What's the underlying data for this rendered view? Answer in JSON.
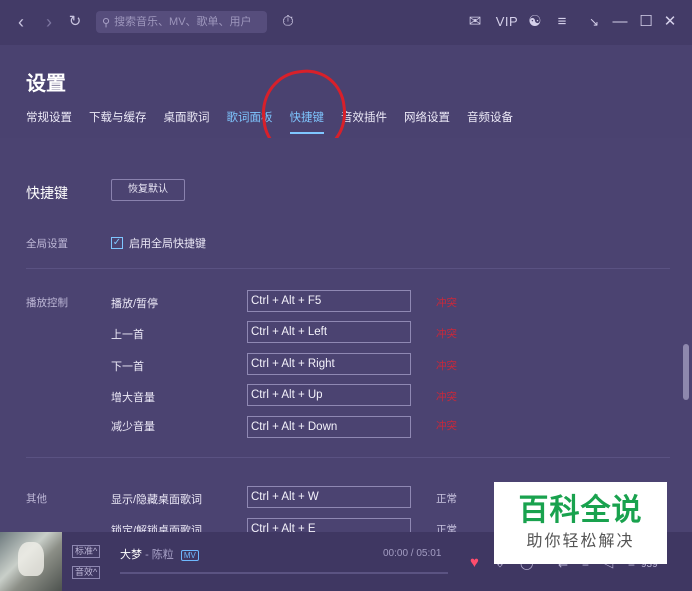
{
  "topbar": {
    "back_icon": "chevron-left-icon",
    "forward_icon": "chevron-right-icon",
    "refresh_icon": "refresh-icon",
    "search_placeholder": "搜索音乐、MV、歌单、用户",
    "recognize_icon": "music-recognize-icon",
    "mail_icon": "mail-icon",
    "vip_label": "VIP",
    "skin_icon": "shirt-icon",
    "menu_icon": "menu-icon",
    "minimode_icon": "mini-mode-icon",
    "minimize_icon": "minimize-icon",
    "maximize_icon": "maximize-icon",
    "close_icon": "close-icon"
  },
  "page_title": "设置",
  "tabs": [
    "常规设置",
    "下载与缓存",
    "桌面歌词",
    "歌词面板",
    "快捷键",
    "音效插件",
    "网络设置",
    "音频设备"
  ],
  "active_tab": "快捷键",
  "shortcuts": {
    "section_title": "快捷键",
    "reset_label": "恢复默认",
    "global_label": "全局设置",
    "global_checkbox_label": "启用全局快捷键",
    "global_checked": true,
    "playback_label": "播放控制",
    "playback_items": [
      {
        "name": "播放/暂停",
        "keys": "Ctrl + Alt + F5",
        "status": "冲突"
      },
      {
        "name": "上一首",
        "keys": "Ctrl + Alt + Left",
        "status": "冲突"
      },
      {
        "name": "下一首",
        "keys": "Ctrl + Alt + Right",
        "status": "冲突"
      },
      {
        "name": "增大音量",
        "keys": "Ctrl + Alt + Up",
        "status": "冲突"
      },
      {
        "name": "减少音量",
        "keys": "Ctrl + Alt + Down",
        "status": "冲突"
      }
    ],
    "other_label": "其他",
    "other_items": [
      {
        "name": "显示/隐藏桌面歌词",
        "keys": "Ctrl + Alt + W",
        "status": "正常"
      },
      {
        "name": "锁定/解锁桌面歌词",
        "keys": "Ctrl + Alt + E",
        "status": "正常"
      }
    ]
  },
  "watermark": {
    "title": "百科全说",
    "subtitle": "助你轻松解决"
  },
  "player": {
    "quality": "标准^",
    "effect": "音效^",
    "song": "大梦",
    "artist": "陈粒",
    "mv_tag": "MV",
    "time": "00:00 / 05:01",
    "count": "939"
  },
  "colors": {
    "accent": "#7fc6ff",
    "conflict": "#c9283a",
    "annotation": "#d8202a",
    "watermark_green": "#19a24e"
  }
}
